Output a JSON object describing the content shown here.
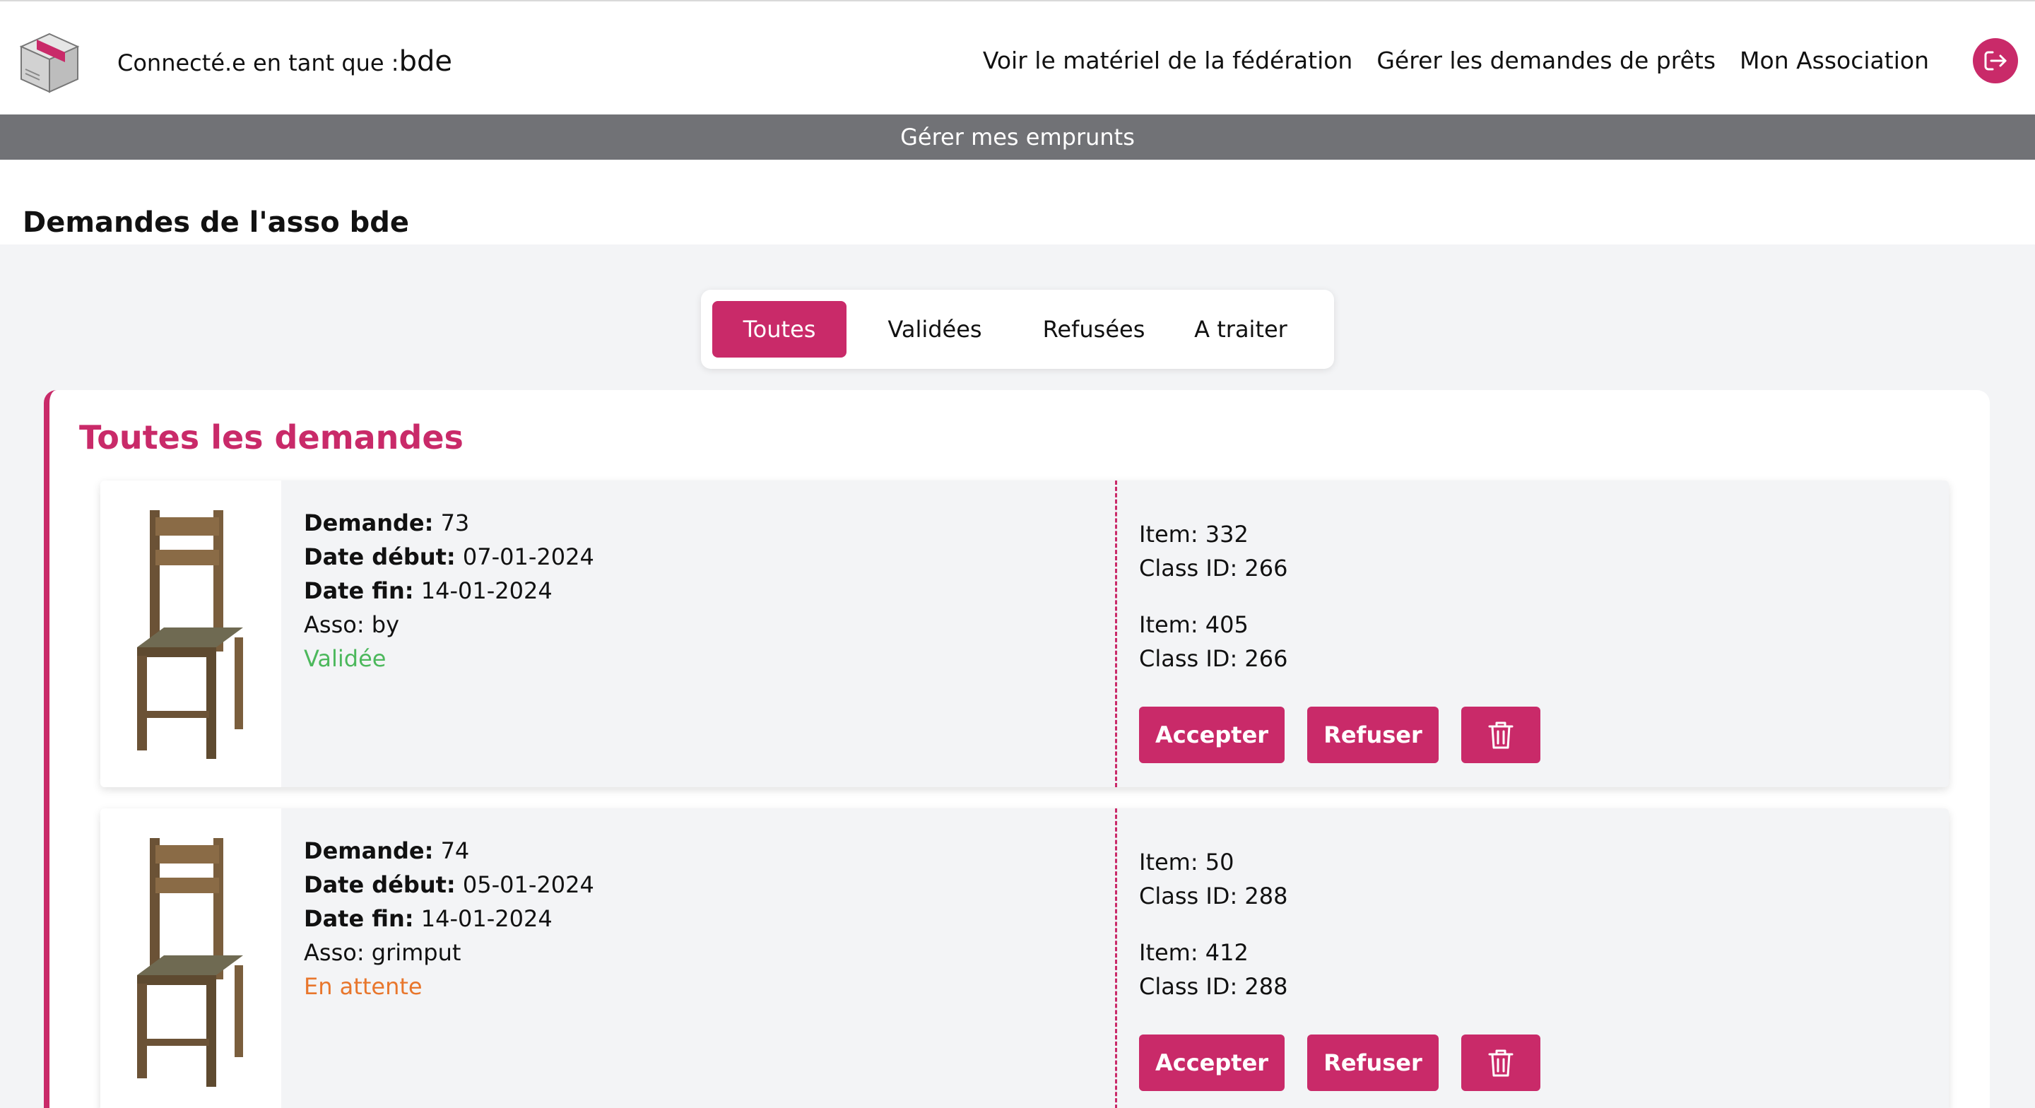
{
  "header": {
    "connected_prefix": "Connecté.e en tant que :",
    "username": "bde",
    "nav": [
      "Voir le matériel de la fédération",
      "Gérer les demandes de prêts",
      "Mon Association"
    ],
    "logo_icon": "box-icon",
    "logout_icon": "logout-icon"
  },
  "subnav": {
    "label": "Gérer mes emprunts"
  },
  "page": {
    "title": "Demandes de l'asso bde"
  },
  "tabs": [
    "Toutes",
    "Validées",
    "Refusées",
    "A traiter"
  ],
  "panel": {
    "title": "Toutes les demandes"
  },
  "labels": {
    "demande": "Demande:",
    "date_debut": "Date début:",
    "date_fin": "Date fin:",
    "asso": "Asso:",
    "item": "Item:",
    "class_id": "Class ID:",
    "accept": "Accepter",
    "refuse": "Refuser"
  },
  "requests": [
    {
      "demande": "73",
      "date_debut": "07-01-2024",
      "date_fin": "14-01-2024",
      "asso": "by",
      "status": "Validée",
      "status_color": "#4cb85c",
      "items": [
        {
          "item": "332",
          "class_id": "266"
        },
        {
          "item": "405",
          "class_id": "266"
        }
      ]
    },
    {
      "demande": "74",
      "date_debut": "05-01-2024",
      "date_fin": "14-01-2024",
      "asso": "grimput",
      "status": "En attente",
      "status_color": "#e8762c",
      "items": [
        {
          "item": "50",
          "class_id": "288"
        },
        {
          "item": "412",
          "class_id": "288"
        }
      ]
    }
  ],
  "colors": {
    "accent": "#c92a69",
    "subbar": "#717276",
    "background": "#f3f4f6"
  }
}
